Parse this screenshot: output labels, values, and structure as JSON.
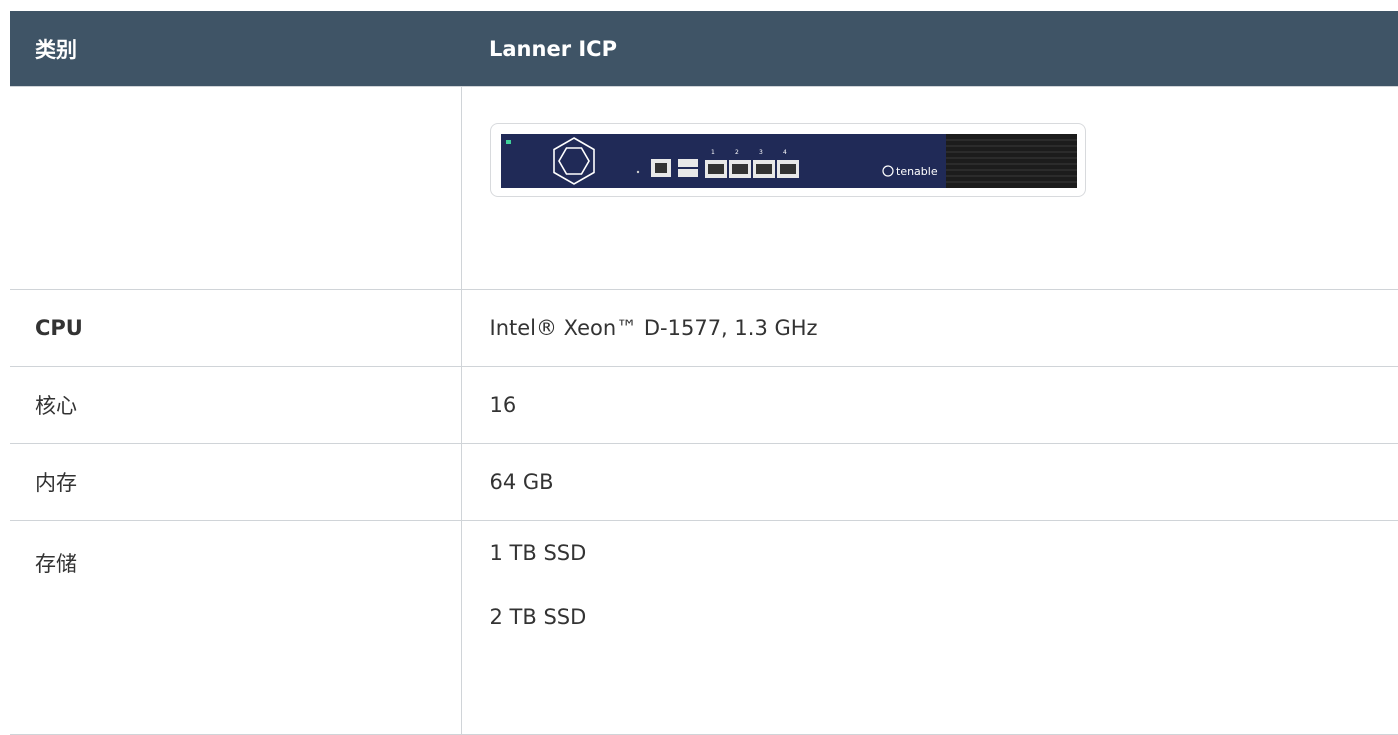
{
  "header": {
    "col1": "类别",
    "col2": "Lanner ICP"
  },
  "rows": [
    {
      "label": "",
      "value": ""
    },
    {
      "label": "CPU",
      "value": "Intel® Xeon™ D-1577, 1.3 GHz"
    },
    {
      "label": "核心",
      "value": "16"
    },
    {
      "label": "内存",
      "value": "64 GB"
    },
    {
      "label": "存储",
      "values": [
        "1 TB SSD",
        "2 TB SSD"
      ]
    }
  ],
  "appliance_image": {
    "brand_label": "tenable",
    "port_numbers": [
      "1",
      "2",
      "3",
      "4"
    ],
    "colors": {
      "chassis": "#202a57",
      "vent": "#1c1c1c"
    }
  }
}
